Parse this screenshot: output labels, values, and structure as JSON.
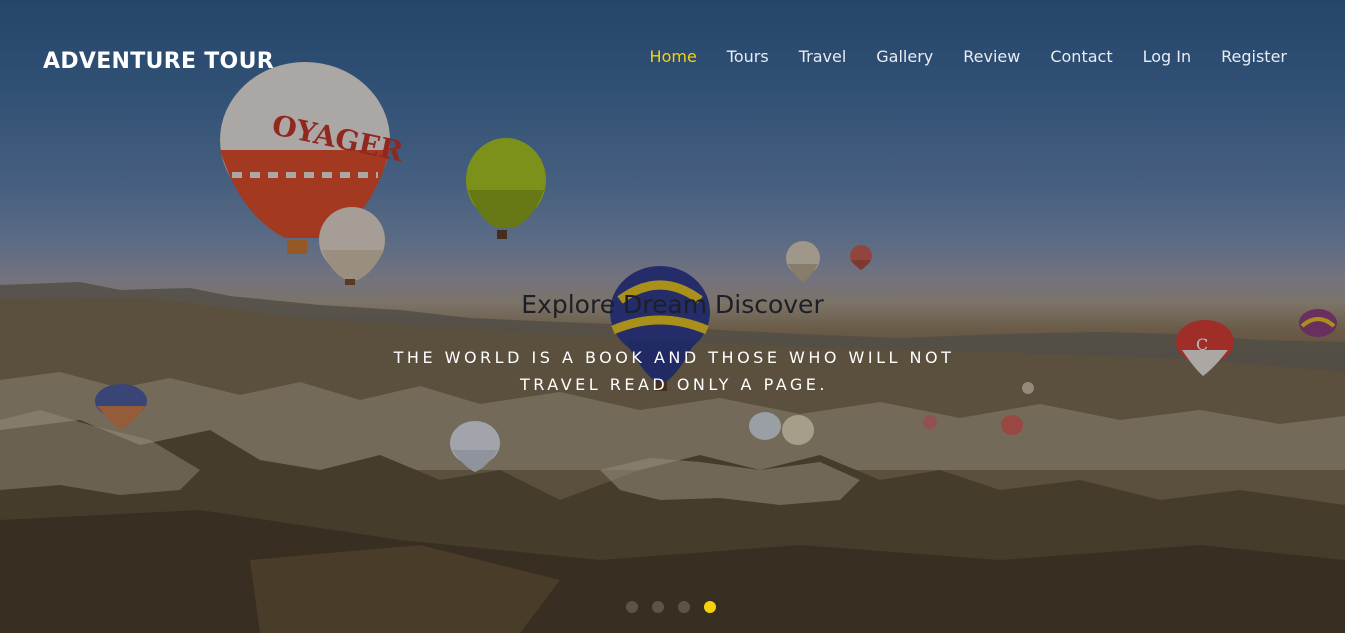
{
  "brand": {
    "name": "ADVENTURE TOUR"
  },
  "nav": {
    "items": [
      {
        "label": "Home",
        "active": true
      },
      {
        "label": "Tours",
        "active": false
      },
      {
        "label": "Travel",
        "active": false
      },
      {
        "label": "Gallery",
        "active": false
      },
      {
        "label": "Review",
        "active": false
      },
      {
        "label": "Contact",
        "active": false
      },
      {
        "label": "Log In",
        "active": false
      },
      {
        "label": "Register",
        "active": false
      }
    ]
  },
  "hero": {
    "title": "Explore Dream Discover",
    "quote": "THE WORLD IS A BOOK AND THOSE WHO WILL NOT TRAVEL READ ONLY A PAGE.",
    "background": "hot-air-balloons-over-valley-photo"
  },
  "carousel": {
    "slide_count": 4,
    "active_index": 3
  },
  "colors": {
    "accent": "#f5d20b",
    "nav_text": "#e9ecf2",
    "brand_text": "#ffffff"
  }
}
